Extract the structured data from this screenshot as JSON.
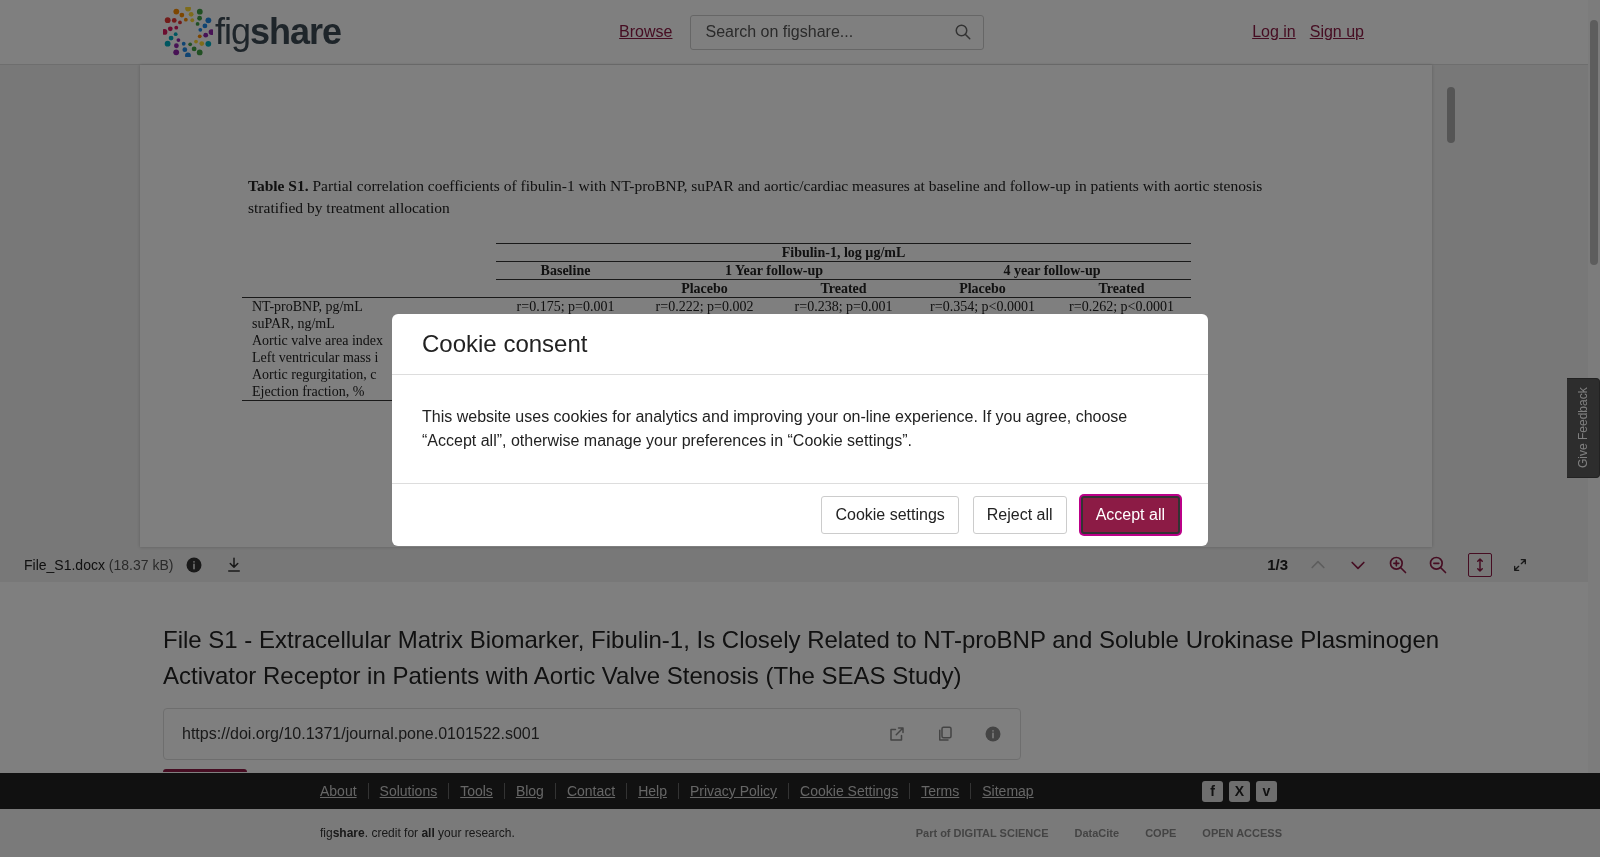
{
  "header": {
    "logo": "fig**share**",
    "nav_link": "Browse",
    "search": {
      "placeholder": "Search on figshare..."
    },
    "auth_links": [
      "Log in",
      "Sign up"
    ]
  },
  "document": {
    "heading_lead": "Table S1.",
    "heading": "Partial correlation coefficients of fibulin-1 with NT-proBNP, suPAR and aortic/cardiac measures at baseline and follow-up in patients with aortic stenosis stratified by treatment allocation",
    "group_header": "Fibulin-1, log µg/mL",
    "period_headers": [
      {
        "label": "Baseline"
      },
      {
        "label": "1 Year follow-up",
        "sub_headers": [
          "Placebo",
          "Treated"
        ]
      },
      {
        "label": "4 year follow-up",
        "sub_headers": [
          "Placebo",
          "Treated"
        ]
      }
    ],
    "rows": [
      {
        "label": "NT-proBNP,  pg/mL",
        "cells": [
          "r=0.175; p=0.001",
          "r=0.222; p=0.002",
          "r=0.238; p=0.001",
          "r=0.354; p<0.0001",
          "r=0.262; p<0.0001"
        ]
      },
      {
        "label": "suPAR,  ng/mL"
      },
      {
        "label": "Aortic valve area index"
      },
      {
        "label": "Left ventricular mass i"
      },
      {
        "label": "Aortic regurgitation, c"
      },
      {
        "label": "Ejection fraction, %"
      }
    ]
  },
  "viewer_toolbar": {
    "file_name": "File_S1.docx",
    "file_size": "(18.37 kB)",
    "page": "1/3",
    "nav_buttons": [
      {
        "kind": "up",
        "disabled": true
      },
      {
        "kind": "down",
        "disabled": false
      }
    ],
    "view_buttons": [
      {
        "kind": "zoom-in",
        "selected": false
      },
      {
        "kind": "zoom-out",
        "selected": false
      },
      {
        "kind": "fit-height",
        "selected": true
      },
      {
        "kind": "fullscreen",
        "selected": false
      }
    ]
  },
  "item": {
    "title": "File S1 - Extracellular Matrix Biomarker, Fibulin-1, Is Closely Related to NT-proBNP and Soluble Urokinase Plasminogen Activator Receptor in Patients with Aortic Valve Stenosis (The SEAS Study)",
    "doi": "https://doi.org/10.1371/journal.pone.0101522.s001"
  },
  "feedback_tab": "Give Feedback",
  "footer": {
    "links": [
      "About",
      "Solutions",
      "Tools",
      "Blog",
      "Contact",
      "Help",
      "Privacy Policy",
      "Cookie Settings",
      "Terms",
      "Sitemap"
    ],
    "social": [
      "f",
      "X",
      "v"
    ],
    "tagline": "fig**share**. credit for **all** your research.",
    "partner_logos": [
      "Part of DIGITAL SCIENCE",
      "DataCite",
      "COPE",
      "OPEN ACCESS"
    ]
  },
  "cookie_dialog": {
    "title": "Cookie consent",
    "message": "This website uses cookies for analytics and improving your on-line experience. If you agree, choose “Accept all”, otherwise manage your preferences in “Cookie settings”.",
    "buttons": [
      {
        "label": "Cookie settings",
        "kind": "secondary"
      },
      {
        "label": "Reject all",
        "kind": "secondary"
      },
      {
        "label": "Accept all",
        "kind": "primary"
      }
    ]
  }
}
